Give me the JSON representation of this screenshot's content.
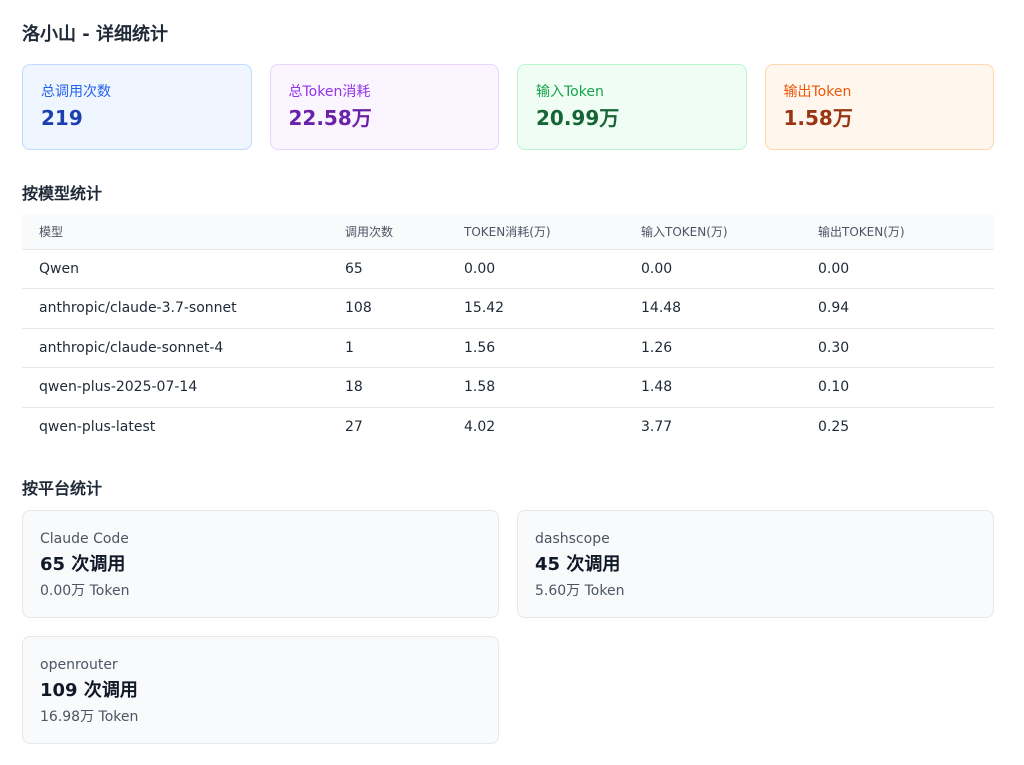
{
  "page": {
    "title": "洛小山 - 详细统计"
  },
  "summary": [
    {
      "label": "总调用次数",
      "value": "219",
      "bg": "#eff6ff",
      "border": "#bfdbfe",
      "label_color": "#2563eb",
      "value_color": "#1e40af"
    },
    {
      "label": "总Token消耗",
      "value": "22.58万",
      "bg": "#faf5ff",
      "border": "#e9d5ff",
      "label_color": "#9333ea",
      "value_color": "#6b21a8"
    },
    {
      "label": "输入Token",
      "value": "20.99万",
      "bg": "#f0fdf4",
      "border": "#bbf7d0",
      "label_color": "#16a34a",
      "value_color": "#166534"
    },
    {
      "label": "输出Token",
      "value": "1.58万",
      "bg": "#fff7ed",
      "border": "#fed7aa",
      "label_color": "#ea580c",
      "value_color": "#9a3412"
    }
  ],
  "by_model": {
    "title": "按模型统计",
    "headers": [
      "模型",
      "调用次数",
      "TOKEN消耗(万)",
      "输入TOKEN(万)",
      "输出TOKEN(万)"
    ],
    "rows": [
      [
        "Qwen",
        "65",
        "0.00",
        "0.00",
        "0.00"
      ],
      [
        "anthropic/claude-3.7-sonnet",
        "108",
        "15.42",
        "14.48",
        "0.94"
      ],
      [
        "anthropic/claude-sonnet-4",
        "1",
        "1.56",
        "1.26",
        "0.30"
      ],
      [
        "qwen-plus-2025-07-14",
        "18",
        "1.58",
        "1.48",
        "0.10"
      ],
      [
        "qwen-plus-latest",
        "27",
        "4.02",
        "3.77",
        "0.25"
      ]
    ]
  },
  "by_platform": {
    "title": "按平台统计",
    "items": [
      {
        "name": "Claude Code",
        "calls": "65 次调用",
        "tokens": "0.00万 Token"
      },
      {
        "name": "dashscope",
        "calls": "45 次调用",
        "tokens": "5.60万 Token"
      },
      {
        "name": "openrouter",
        "calls": "109 次调用",
        "tokens": "16.98万 Token"
      }
    ]
  }
}
